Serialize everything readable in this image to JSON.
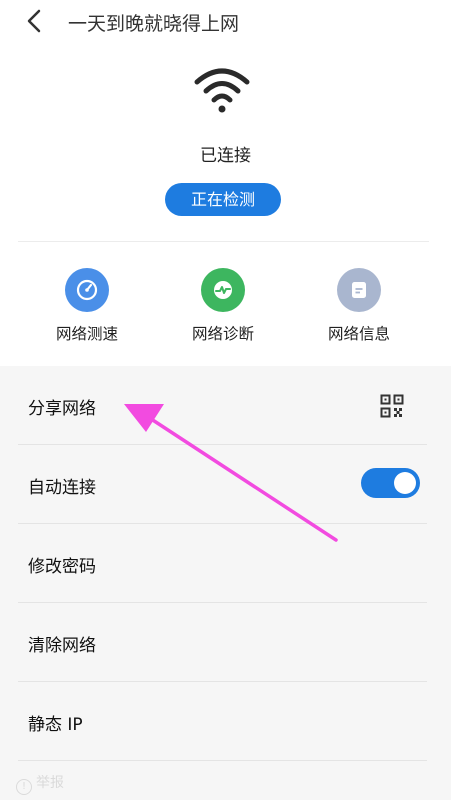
{
  "header": {
    "title": "一天到晚就晓得上网"
  },
  "connection": {
    "status": "已连接",
    "check_button": "正在检测"
  },
  "tools": [
    {
      "label": "网络测速",
      "icon": "speedometer-icon",
      "color": "#4a8fe8"
    },
    {
      "label": "网络诊断",
      "icon": "pulse-icon",
      "color": "#3db65f"
    },
    {
      "label": "网络信息",
      "icon": "document-icon",
      "color": "#a9b6cf"
    }
  ],
  "settings": [
    {
      "label": "分享网络",
      "control": "qr-code-icon"
    },
    {
      "label": "自动连接",
      "control": "toggle",
      "enabled": true
    },
    {
      "label": "修改密码"
    },
    {
      "label": "清除网络"
    },
    {
      "label": "静态 IP"
    }
  ],
  "bottom": {
    "label": "举报"
  },
  "accent_color": "#1e7ce0",
  "annotation_color": "#f24be0"
}
